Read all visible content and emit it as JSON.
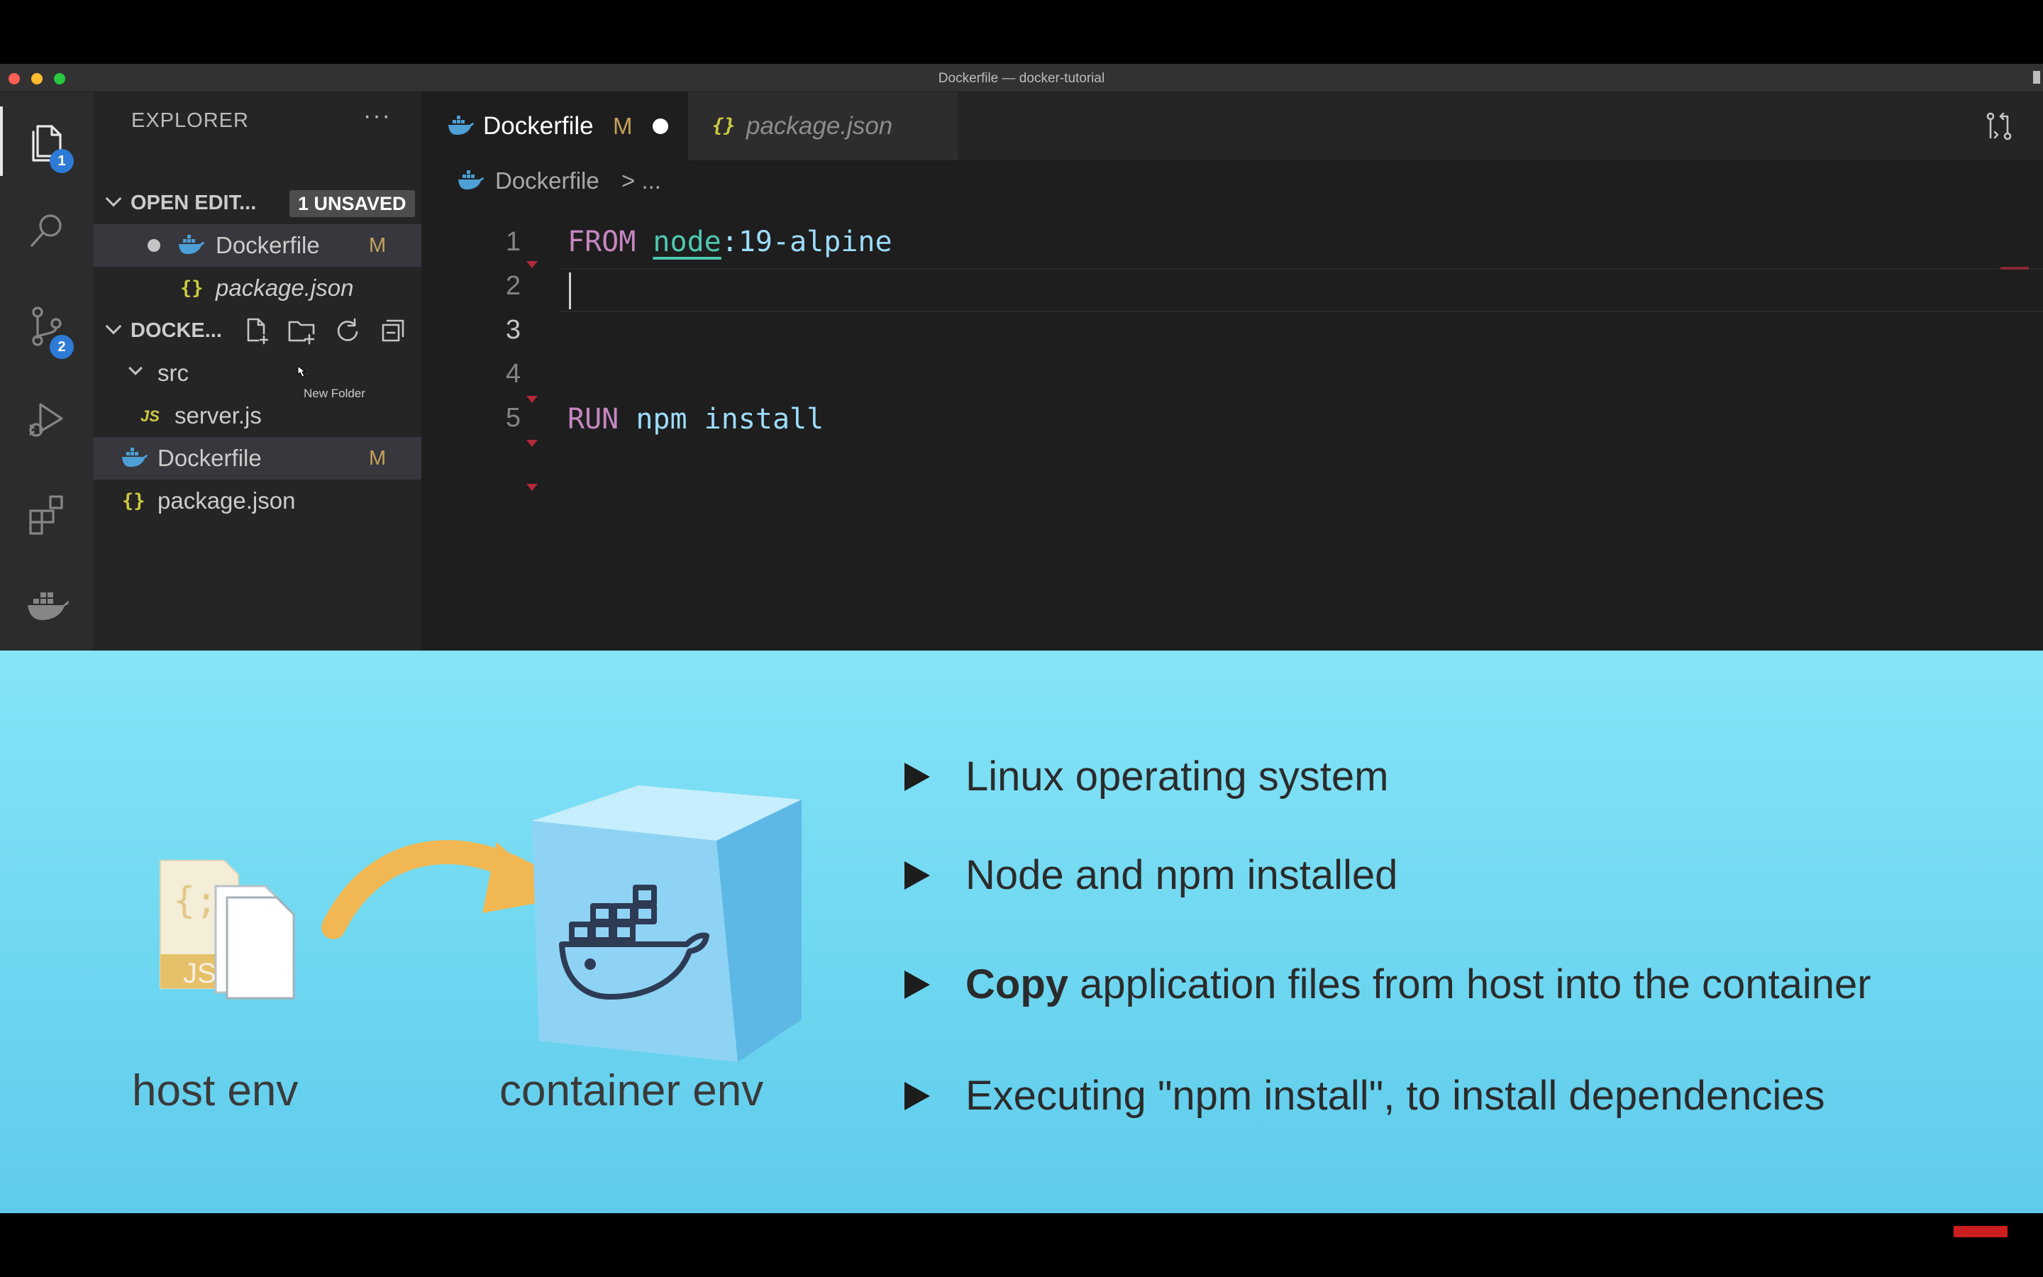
{
  "window": {
    "title": "Dockerfile — docker-tutorial"
  },
  "activity_bar": {
    "items": [
      {
        "icon": "files-icon",
        "badge": "1"
      },
      {
        "icon": "search-icon"
      },
      {
        "icon": "source-control-icon",
        "badge": "2"
      },
      {
        "icon": "run-debug-icon"
      },
      {
        "icon": "extensions-icon"
      },
      {
        "icon": "docker-icon"
      }
    ]
  },
  "sidebar": {
    "title": "EXPLORER",
    "more": "···",
    "open_editors": {
      "title": "OPEN EDIT...",
      "badge": "1 UNSAVED",
      "items": [
        {
          "label": "Dockerfile",
          "status": "M"
        },
        {
          "label": "package.json"
        }
      ]
    },
    "folder": {
      "title": "DOCKE...",
      "tooltip": "New Folder",
      "tree": [
        {
          "label": "src"
        },
        {
          "label": "server.js",
          "icon_text": "JS"
        },
        {
          "label": "Dockerfile",
          "status": "M"
        },
        {
          "label": "package.json"
        }
      ]
    }
  },
  "tabs": [
    {
      "label": "Dockerfile",
      "status": "M"
    },
    {
      "label": "package.json"
    }
  ],
  "breadcrumb": {
    "file": "Dockerfile",
    "rest": "> ..."
  },
  "editor": {
    "line_numbers": [
      "1",
      "2",
      "3",
      "4",
      "5"
    ],
    "line1": {
      "keyword": "FROM",
      "image": "node",
      "tag": ":19-alpine"
    },
    "line5": {
      "keyword": "RUN",
      "command": "npm install"
    }
  },
  "slide": {
    "host_label": "host env",
    "container_label": "container env",
    "bullets": [
      {
        "bold": "",
        "text": "Linux operating system"
      },
      {
        "bold": "",
        "text": "Node and npm installed"
      },
      {
        "bold": "Copy",
        "text": " application files from host into the container"
      },
      {
        "bold": "",
        "text": "Executing \"npm install\", to install dependencies"
      }
    ],
    "file_icon_text": {
      "json": "{;}",
      "js": "JS"
    }
  },
  "colors": {
    "accent_badge": "#2d7bd6",
    "modified": "#c5a15a",
    "slide_bg": "#74dbf2",
    "arrow": "#f0b752"
  }
}
